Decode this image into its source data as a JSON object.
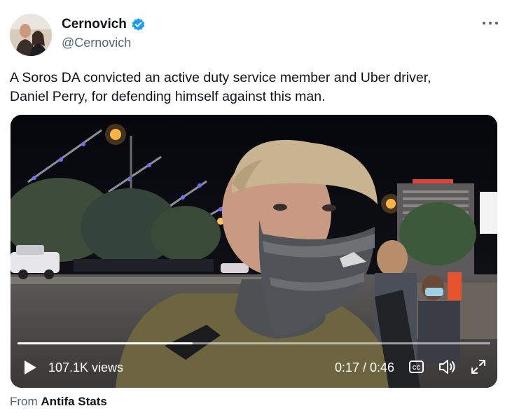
{
  "author": {
    "display_name": "Cernovich",
    "handle": "@Cernovich",
    "verified": true
  },
  "tweet": {
    "text_line1": "A Soros DA convicted an active duty service member and Uber driver,",
    "text_line2": "Daniel Perry, for defending himself against this man."
  },
  "video": {
    "views": "107.1K views",
    "time": "0:17 / 0:46",
    "progress_fraction": 0.37,
    "cc_label": "CC"
  },
  "source": {
    "prefix": "From",
    "name": "Antifa Stats"
  },
  "colors": {
    "verified": "#1d9bf0",
    "text": "#0f1419",
    "secondary": "#536471"
  },
  "icons": {
    "verified": "verified-badge-icon",
    "more": "more-icon",
    "play": "play-icon",
    "cc": "closed-captions-icon",
    "volume": "volume-icon",
    "fullscreen": "fullscreen-icon"
  }
}
